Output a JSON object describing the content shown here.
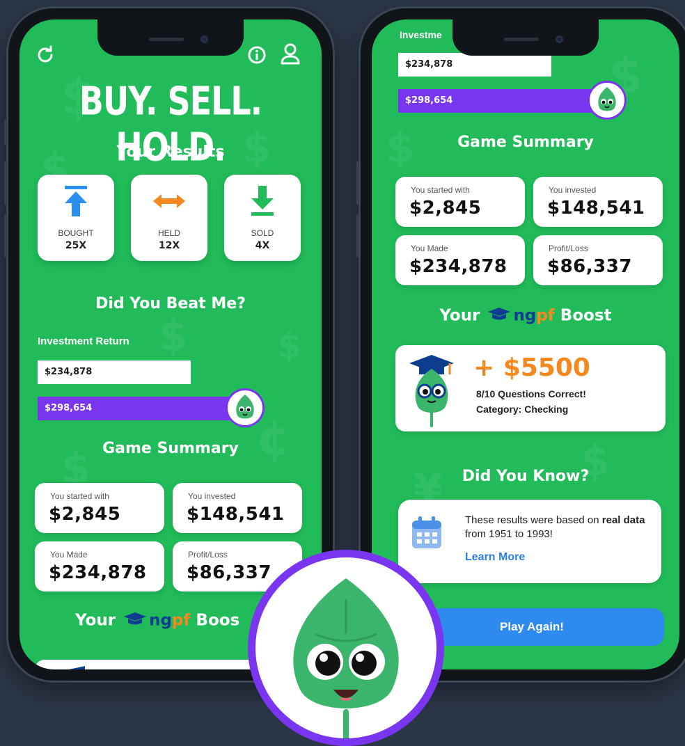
{
  "colors": {
    "background": "#2b3647",
    "screen_green": "#21bb59",
    "purple": "#7a35f0",
    "blue_button": "#2f8af0",
    "boost_orange": "#f5891f",
    "ngpf_blue": "#0c3d8f"
  },
  "left_screen": {
    "top_bar": {
      "refresh_icon": "refresh-icon",
      "info_icon": "info-icon",
      "profile_icon": "user-icon"
    },
    "title": "BUY. SELL. HOLD.",
    "results_heading": "Your Results",
    "tiles": [
      {
        "label": "BOUGHT",
        "value": "25X",
        "icon": "arrow-up-icon",
        "color": "#2a8ff0"
      },
      {
        "label": "HELD",
        "value": "12X",
        "icon": "double-arrow-icon",
        "color": "#f5891f"
      },
      {
        "label": "SOLD",
        "value": "4X",
        "icon": "download-icon",
        "color": "#21bb59"
      }
    ],
    "beat_heading": "Did You Beat Me?",
    "investment_return_label": "Investment Return",
    "bars": [
      {
        "value": "$234,878",
        "fraction": 0.79
      },
      {
        "value": "$298,654",
        "fraction": 1.0
      }
    ],
    "summary_heading": "Game Summary",
    "summary_cards": [
      {
        "label": "You started with",
        "value": "$2,845"
      },
      {
        "label": "You invested",
        "value": "$148,541"
      },
      {
        "label": "You Made",
        "value": "$234,878"
      },
      {
        "label": "Profit/Loss",
        "value": "$86,337"
      }
    ],
    "boost": {
      "your": "Your",
      "ng": "ng",
      "pf": "pf",
      "suffix": "Boos"
    }
  },
  "right_screen": {
    "partial_label": "Investme",
    "bars": [
      {
        "value": "$234,878",
        "fraction": 0.79
      },
      {
        "value": "$298,654",
        "fraction": 1.0
      }
    ],
    "summary_heading": "Game Summary",
    "summary_cards": [
      {
        "label": "You started with",
        "value": "$2,845"
      },
      {
        "label": "You invested",
        "value": "$148,541"
      },
      {
        "label": "You Made",
        "value": "$234,878"
      },
      {
        "label": "Profit/Loss",
        "value": "$86,337"
      }
    ],
    "boost": {
      "your": "Your",
      "ng": "ng",
      "pf": "pf",
      "suffix": "Boost"
    },
    "boost_card": {
      "amount": "+ $5500",
      "questions": "8/10 Questions Correct!",
      "category": "Category: Checking",
      "icon": "graduate-mascot-icon"
    },
    "know_heading": "Did You Know?",
    "know_card": {
      "text_prefix": "These results were based on",
      "text_bold": "real data",
      "text_suffix": "from 1951 to 1993!",
      "link": "Learn More",
      "icon": "calendar-icon"
    },
    "play_again": "Play Again!"
  },
  "mascot": {
    "icon": "leaf-mascot-icon"
  }
}
